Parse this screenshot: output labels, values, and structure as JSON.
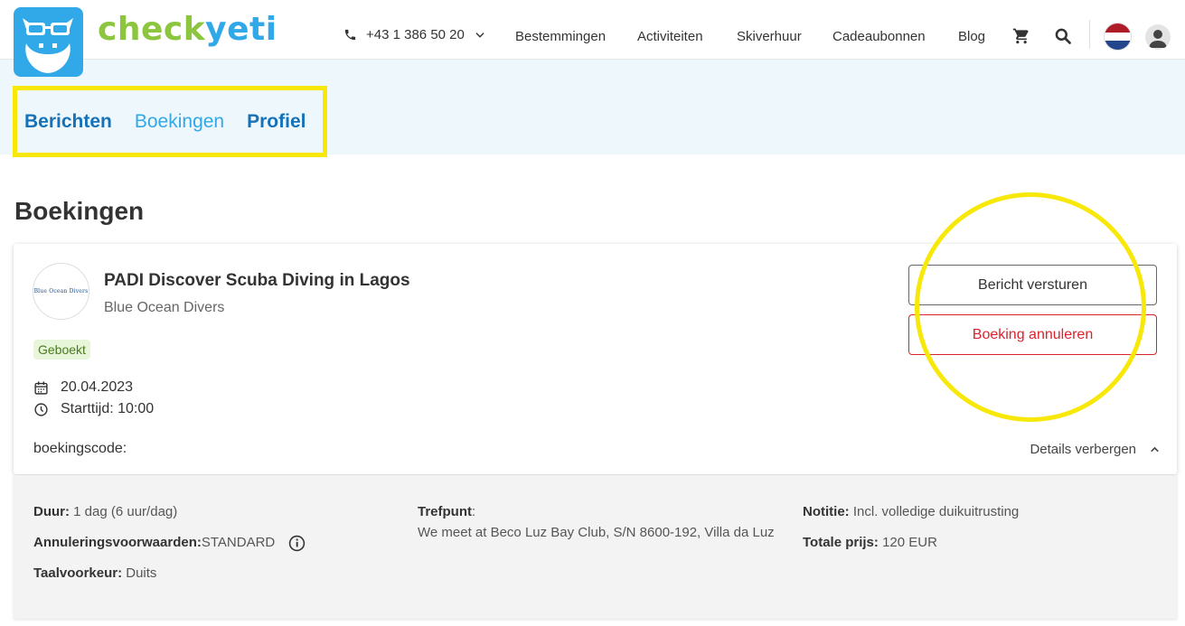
{
  "brand": {
    "part1": "check",
    "part2": "yeti",
    "color_green": "#8cc63f",
    "color_blue": "#31a8e8"
  },
  "header": {
    "phone": "+43 1 386 50 20",
    "nav": [
      "Bestemmingen",
      "Activiteiten",
      "Skiverhuur",
      "Cadeaubonnen",
      "Blog"
    ],
    "icons": [
      "phone-icon",
      "chevron-down-icon",
      "cart-icon",
      "search-icon",
      "flag-nl-icon",
      "user-icon"
    ]
  },
  "subnav": {
    "tabs": [
      {
        "label": "Berichten",
        "active": false
      },
      {
        "label": "Boekingen",
        "active": true
      },
      {
        "label": "Profiel",
        "active": false
      }
    ]
  },
  "page": {
    "title": "Boekingen"
  },
  "booking": {
    "provider_logo_text": "Blue Ocean Divers",
    "title": "PADI Discover Scuba Diving in Lagos",
    "provider": "Blue Ocean Divers",
    "status": "Geboekt",
    "date": "20.04.2023",
    "start_time": "Starttijd: 10:00",
    "booking_code_label": "boekingscode:",
    "details_toggle": "Details verbergen",
    "btn_message": "Bericht versturen",
    "btn_cancel": "Boeking annuleren"
  },
  "details": {
    "duration_label": "Duur:",
    "duration_value": " 1 dag (6 uur/dag)",
    "cancel_label": "Annuleringsvoorwaarden:",
    "cancel_value": " STANDARD",
    "language_label": "Taalvoorkeur:",
    "language_value": " Duits",
    "meeting_label": "Trefpunt",
    "meeting_colon": ":",
    "meeting_value": "We meet at Beco Luz Bay Club, S/N 8600-192, Villa da Luz",
    "note_label": "Notitie:",
    "note_value": " Incl. volledige duikuitrusting",
    "price_label": "Totale prijs:",
    "price_value": " 120 EUR"
  },
  "colors": {
    "accent": "#31a8e8",
    "link": "#1572b8",
    "danger": "#d9232d",
    "highlight": "#f7e80a",
    "status_bg": "#e7f6d8"
  }
}
